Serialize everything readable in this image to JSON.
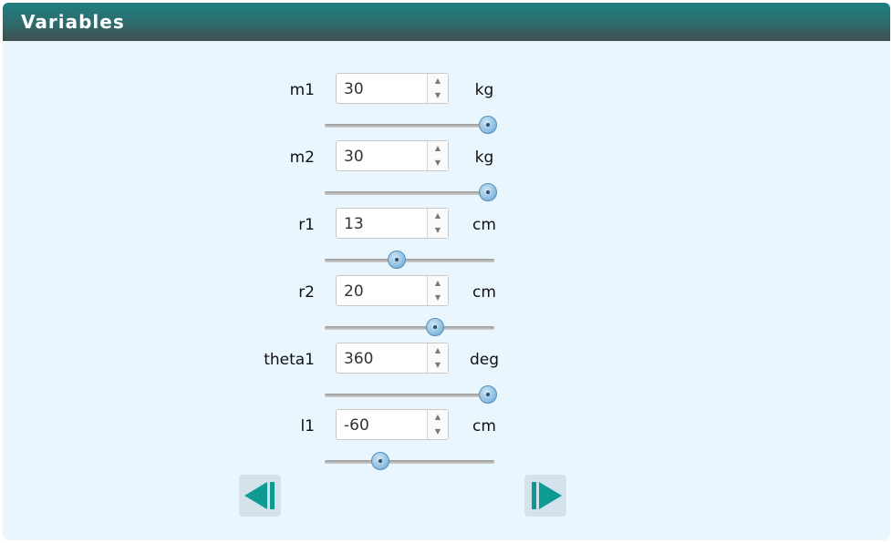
{
  "header": {
    "title": "Variables"
  },
  "variables": [
    {
      "name": "m1",
      "value": "30",
      "unit": "kg",
      "slider_fraction": 1.0
    },
    {
      "name": "m2",
      "value": "30",
      "unit": "kg",
      "slider_fraction": 1.0
    },
    {
      "name": "r1",
      "value": "13",
      "unit": "cm",
      "slider_fraction": 0.43
    },
    {
      "name": "r2",
      "value": "20",
      "unit": "cm",
      "slider_fraction": 0.67
    },
    {
      "name": "theta1",
      "value": "360",
      "unit": "deg",
      "slider_fraction": 1.0
    },
    {
      "name": "l1",
      "value": "-60",
      "unit": "cm",
      "slider_fraction": 0.33
    }
  ],
  "navigation": {
    "previous_icon": "previous-icon",
    "next_icon": "next-icon"
  },
  "colors": {
    "header_gradient_top": "#1d7f80",
    "header_gradient_bottom": "#424f50",
    "panel_background": "#eaf6fd",
    "nav_arrow": "#0f9a94"
  }
}
